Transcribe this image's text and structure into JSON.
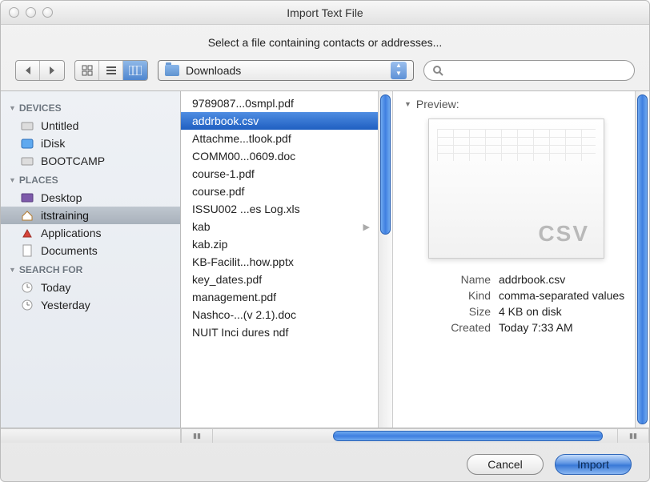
{
  "window": {
    "title": "Import Text File",
    "subtitle": "Select a file containing contacts or addresses..."
  },
  "path_popup": {
    "label": "Downloads"
  },
  "search": {
    "placeholder": ""
  },
  "sidebar": {
    "sections": [
      {
        "label": "DEVICES",
        "items": [
          {
            "label": "Untitled"
          },
          {
            "label": "iDisk"
          },
          {
            "label": "BOOTCAMP"
          }
        ]
      },
      {
        "label": "PLACES",
        "items": [
          {
            "label": "Desktop"
          },
          {
            "label": "itstraining",
            "selected": true
          },
          {
            "label": "Applications"
          },
          {
            "label": "Documents"
          }
        ]
      },
      {
        "label": "SEARCH FOR",
        "items": [
          {
            "label": "Today"
          },
          {
            "label": "Yesterday"
          }
        ]
      }
    ]
  },
  "files": [
    {
      "name": "9789087...0smpl.pdf"
    },
    {
      "name": "addrbook.csv",
      "selected": true
    },
    {
      "name": "Attachme...tlook.pdf"
    },
    {
      "name": "COMM00...0609.doc"
    },
    {
      "name": "course-1.pdf"
    },
    {
      "name": "course.pdf"
    },
    {
      "name": "ISSU002 ...es Log.xls"
    },
    {
      "name": "kab",
      "arrow": true
    },
    {
      "name": "kab.zip"
    },
    {
      "name": "KB-Facilit...how.pptx"
    },
    {
      "name": "key_dates.pdf"
    },
    {
      "name": "management.pdf"
    },
    {
      "name": "Nashco-...(v 2.1).doc"
    },
    {
      "name": "NUIT  Inci    dures ndf"
    }
  ],
  "preview": {
    "header": "Preview:",
    "thumb_label": "CSV",
    "meta": {
      "name_k": "Name",
      "name_v": "addrbook.csv",
      "kind_k": "Kind",
      "kind_v": "comma-separated values",
      "size_k": "Size",
      "size_v": "4 KB on disk",
      "created_k": "Created",
      "created_v": "Today 7:33 AM"
    }
  },
  "buttons": {
    "cancel": "Cancel",
    "import": "Import"
  }
}
